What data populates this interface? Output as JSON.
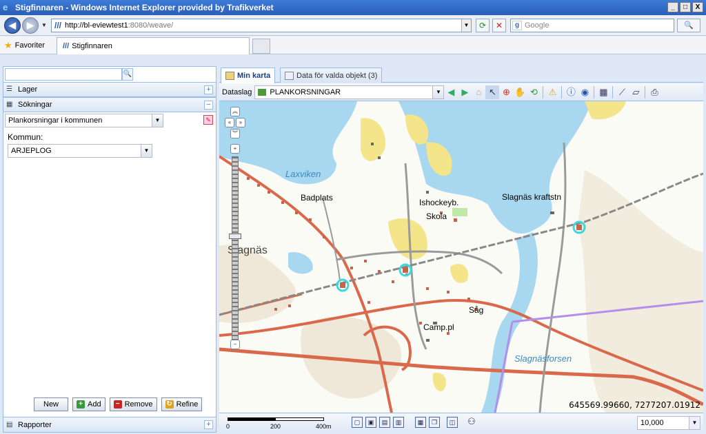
{
  "window": {
    "title": "Stigfinnaren - Windows Internet Explorer provided by Trafikverket",
    "controls": {
      "minimize": "_",
      "maximize": "□",
      "close": "X"
    }
  },
  "browser": {
    "address_host": "http://bl-eviewtest1",
    "address_path": ":8080/weave/",
    "search_placeholder": "Google",
    "favorites_label": "Favoriter",
    "tab_title": "Stigfinnaren"
  },
  "left_panel": {
    "search_value": "",
    "sections": {
      "lager": "Lager",
      "sokningar": "Sökningar",
      "rapporter": "Rapporter"
    },
    "search_type": "Plankorsningar i kommunen",
    "kommun_label": "Kommun:",
    "kommun_value": "ARJEPLOG",
    "buttons": {
      "new": "New",
      "add": "Add",
      "remove": "Remove",
      "refine": "Refine"
    }
  },
  "right_panel": {
    "tabs": [
      {
        "label": "Min karta",
        "active": true
      },
      {
        "label": "Data för valda objekt (3)",
        "active": false
      }
    ],
    "dataslag_label": "Dataslag",
    "dataslag_value": "PLANKORSNINGAR"
  },
  "map": {
    "labels": {
      "laxviken": "Laxviken",
      "badplats": "Badplats",
      "ishockeyb": "Ishockeyb.",
      "skola": "Skola",
      "slagnas": "Slagnäs",
      "slagnas_kraftstn": "Slagnäs kraftstn",
      "sag": "Såg",
      "camp": "Camp.pl",
      "slagnasforsen": "Slagnäsforsen"
    },
    "coordinates": "645569.99660, 7277207.01912",
    "scale_ticks": [
      "0",
      "200",
      "400m"
    ],
    "scale_value": "10,000",
    "colors": {
      "water": "#a8d8f0",
      "road": "#d9694a",
      "railway": "#888888",
      "boundary": "#b48ee8",
      "crossing": "#3fd6e0"
    }
  }
}
